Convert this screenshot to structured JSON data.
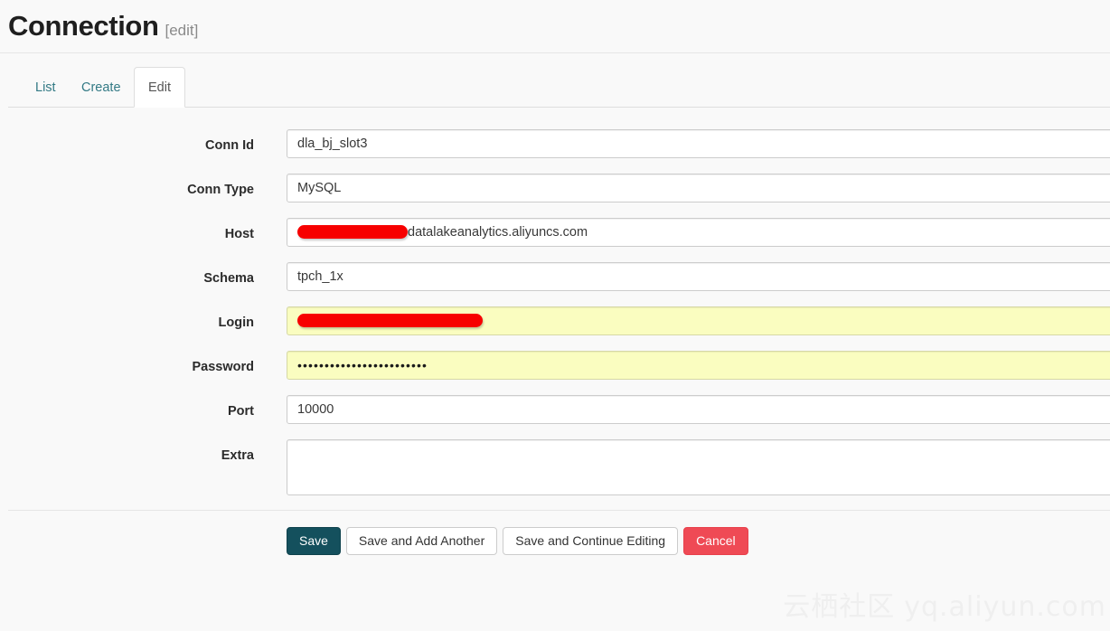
{
  "header": {
    "title": "Connection",
    "subtitle": "[edit]"
  },
  "tabs": [
    {
      "label": "List",
      "name": "tab-list",
      "active": false
    },
    {
      "label": "Create",
      "name": "tab-create",
      "active": false
    },
    {
      "label": "Edit",
      "name": "tab-edit",
      "active": true
    }
  ],
  "form": {
    "fields": [
      {
        "label": "Conn Id",
        "value": "dla_bj_slot3"
      },
      {
        "label": "Conn Type",
        "value": "MySQL"
      },
      {
        "label": "Host",
        "value": "datalakeanalytics.aliyuncs.com",
        "redacted_prefix": true
      },
      {
        "label": "Schema",
        "value": "tpch_1x"
      },
      {
        "label": "Login",
        "value": "",
        "redacted_value": true,
        "autofill": true
      },
      {
        "label": "Password",
        "value": "••••••••••••••••••••••••",
        "autofill": true
      },
      {
        "label": "Port",
        "value": "10000"
      },
      {
        "label": "Extra",
        "value": "",
        "textarea": true
      }
    ]
  },
  "actions": {
    "save": "Save",
    "save_add_another": "Save and Add Another",
    "save_continue": "Save and Continue Editing",
    "cancel": "Cancel"
  },
  "watermark": {
    "cn": "云栖社区",
    "domain": "yq.aliyun.com"
  },
  "colors": {
    "page_background": "#f9f9f9",
    "tab_link": "#337a85",
    "save_button": "#14505d",
    "cancel_button": "#ef4a55",
    "autofill_yellow": "#fafdc0",
    "redaction_red": "#f70000",
    "watermark_gray": "#efefef"
  }
}
